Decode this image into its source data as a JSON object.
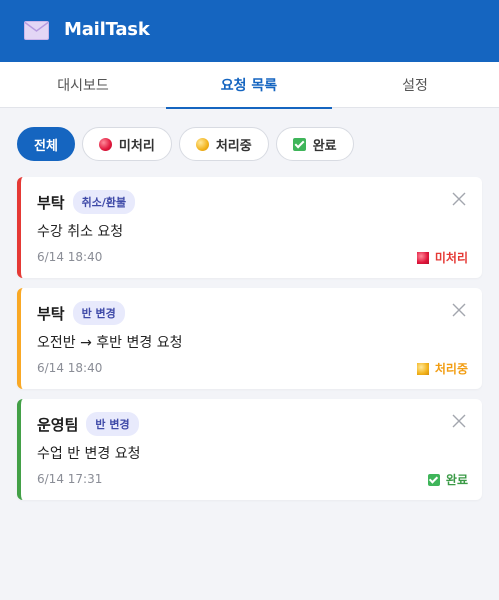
{
  "app": {
    "title": "MailTask",
    "logo_icon": "envelope-icon"
  },
  "tabs": [
    {
      "label": "대시보드",
      "active": false
    },
    {
      "label": "요청 목록",
      "active": true
    },
    {
      "label": "설정",
      "active": false
    }
  ],
  "filters": [
    {
      "label": "전체",
      "active": true,
      "icon": ""
    },
    {
      "label": "미처리",
      "active": false,
      "icon": "red-circle-icon"
    },
    {
      "label": "처리중",
      "active": false,
      "icon": "yellow-circle-icon"
    },
    {
      "label": "완료",
      "active": false,
      "icon": "check-box-icon"
    }
  ],
  "colors": {
    "primary": "#1565c0",
    "pending": "#e53935",
    "in_progress": "#f9a825",
    "done": "#43a047"
  },
  "requests": [
    {
      "sender": "부탁",
      "tag": "취소/환불",
      "description": "수강 취소 요청",
      "time": "6/14 18:40",
      "status": "미처리",
      "status_color": "#e53935",
      "status_icon": "red-circle-icon"
    },
    {
      "sender": "부탁",
      "tag": "반 변경",
      "description": "오전반 → 후반 변경 요청",
      "time": "6/14 18:40",
      "status": "처리중",
      "status_color": "#f9a825",
      "status_icon": "yellow-circle-icon"
    },
    {
      "sender": "운영팀",
      "tag": "반 변경",
      "description": "수업 반 변경 요청",
      "time": "6/14 17:31",
      "status": "완료",
      "status_color": "#43a047",
      "status_icon": "check-box-icon"
    }
  ]
}
